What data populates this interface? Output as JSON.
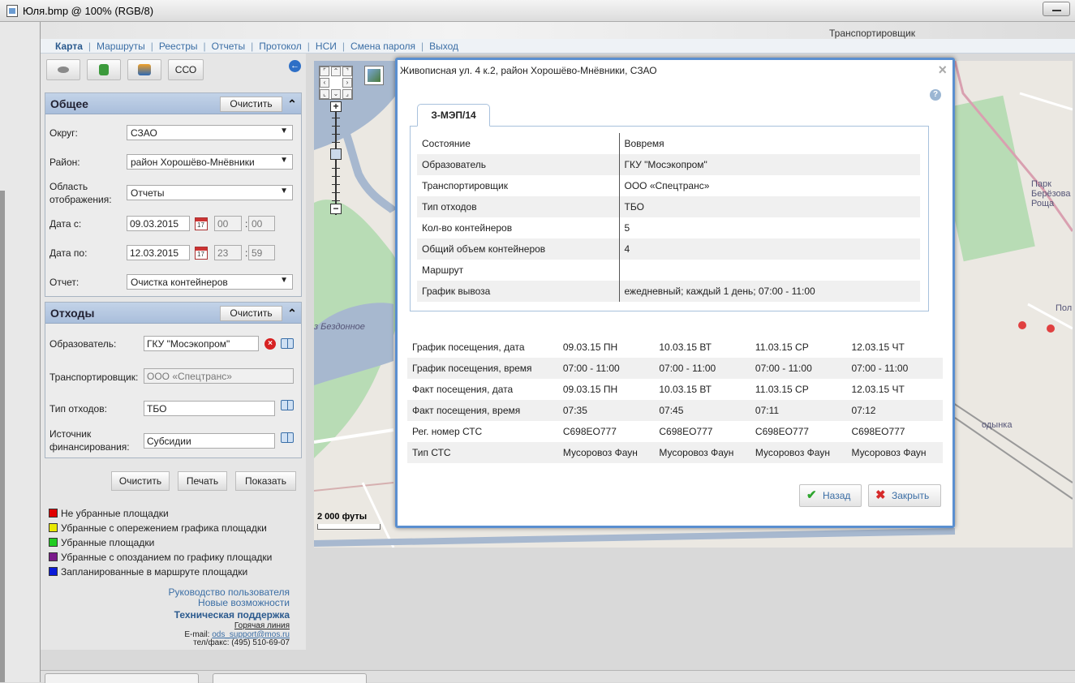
{
  "window": {
    "title": "Юля.bmp @ 100% (RGB/8)"
  },
  "header": {
    "role": "Транспортировщик"
  },
  "nav": [
    "Карта",
    "Маршруты",
    "Реестры",
    "Отчеты",
    "Протокол",
    "НСИ",
    "Смена пароля",
    "Выход"
  ],
  "toolbar": {
    "cco_label": "ССО"
  },
  "general": {
    "title": "Общее",
    "clear": "Очистить",
    "okrug_label": "Округ:",
    "okrug_value": "СЗАО",
    "rayon_label": "Район:",
    "rayon_value": "район Хорошёво-Мнёвники",
    "area_label_1": "Область",
    "area_label_2": "отображения:",
    "area_value": "Отчеты",
    "date_from_label": "Дата с:",
    "date_from": "09.03.2015",
    "time_from_h": "00",
    "time_from_m": "00",
    "date_to_label": "Дата по:",
    "date_to": "12.03.2015",
    "time_to_h": "23",
    "time_to_m": "59",
    "report_label": "Отчет:",
    "report_value": "Очистка контейнеров"
  },
  "waste": {
    "title": "Отходы",
    "clear": "Очистить",
    "producer_label": "Образователь:",
    "producer_value": "ГКУ \"Мосэкопром\"",
    "carrier_label": "Транспортировщик:",
    "carrier_value": "ООО «Спецтранс»",
    "type_label": "Тип отходов:",
    "type_value": "ТБО",
    "funding_label_1": "Источник",
    "funding_label_2": "финансирования:",
    "funding_value": "Субсидии"
  },
  "actions": {
    "clear": "Очистить",
    "print": "Печать",
    "show": "Показать"
  },
  "legend": [
    {
      "label": "Не убранные площадки",
      "color": "#e00000"
    },
    {
      "label": "Убранные с опережением графика площадки",
      "color": "#e8e800"
    },
    {
      "label": "Убранные площадки",
      "color": "#22cc22"
    },
    {
      "label": "Убранные с опозданием по графику площадки",
      "color": "#7a1a8a"
    },
    {
      "label": "Запланированные в маршруте площадки",
      "color": "#0a1ad8"
    }
  ],
  "links": {
    "manual": "Руководство пользователя",
    "news": "Новые возможности",
    "support": "Техническая поддержка"
  },
  "contact": {
    "hotline": "Горячая линия",
    "email_label": "E-mail:",
    "email": "ods_support@mos.ru",
    "phone": "тел/факс: (495) 510-69-07"
  },
  "map": {
    "scale": "2 000 футы",
    "park_1": "Парк",
    "park_2": "Берёзова",
    "park_3": "Роща",
    "pol": "Пол",
    "river": "з Бездонное",
    "station": "одынка"
  },
  "dialog": {
    "title": "Живописная ул. 4 к.2, район Хорошёво-Мнёвники, СЗАО",
    "tab": "З-МЭП/14",
    "info": [
      {
        "k": "Состояние",
        "v": "Вовремя"
      },
      {
        "k": "Образователь",
        "v": "ГКУ \"Мосэкопром\""
      },
      {
        "k": "Транспортировщик",
        "v": "ООО «Спецтранс»"
      },
      {
        "k": "Тип отходов",
        "v": "ТБО"
      },
      {
        "k": "Кол-во контейнеров",
        "v": "5"
      },
      {
        "k": "Общий объем контейнеров",
        "v": "4"
      },
      {
        "k": "Маршрут",
        "v": ""
      },
      {
        "k": "График вывоза",
        "v": "ежедневный; каждый 1 день; 07:00 - 11:00"
      }
    ],
    "visits": [
      {
        "k": "График посещения, дата",
        "v": [
          "09.03.15 ПН",
          "10.03.15 ВТ",
          "11.03.15 СР",
          "12.03.15 ЧТ"
        ]
      },
      {
        "k": "График посещения, время",
        "v": [
          "07:00 - 11:00",
          "07:00 - 11:00",
          "07:00 - 11:00",
          "07:00 - 11:00"
        ]
      },
      {
        "k": "Факт посещения, дата",
        "v": [
          "09.03.15 ПН",
          "10.03.15 ВТ",
          "11.03.15 СР",
          "12.03.15 ЧТ"
        ]
      },
      {
        "k": "Факт посещения, время",
        "v": [
          "07:35",
          "07:45",
          "07:11",
          "07:12"
        ]
      },
      {
        "k": "Рег. номер СТС",
        "v": [
          "С698ЕО777",
          "С698ЕО777",
          "С698ЕО777",
          "С698ЕО777"
        ]
      },
      {
        "k": "Тип СТС",
        "v": [
          "Мусоровоз Фаун",
          "Мусоровоз Фаун",
          "Мусоровоз Фаун",
          "Мусоровоз Фаун"
        ]
      }
    ],
    "back": "Назад",
    "close": "Закрыть"
  }
}
